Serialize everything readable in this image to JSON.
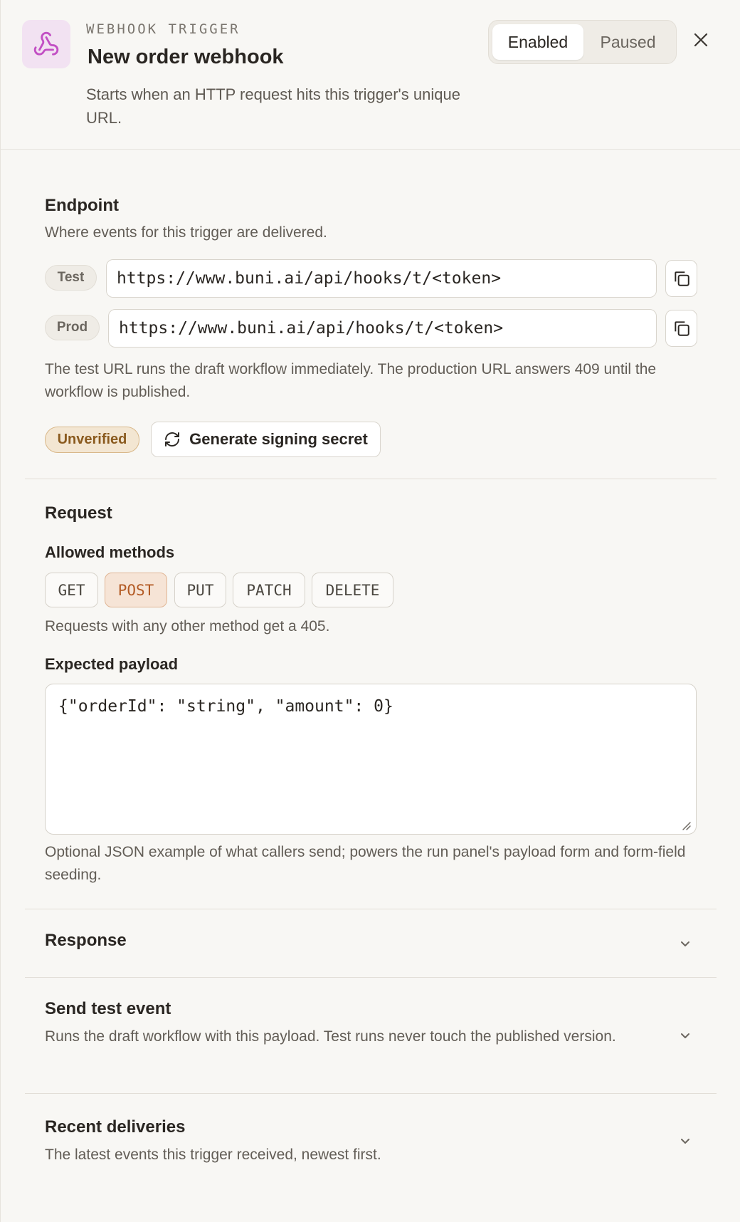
{
  "header": {
    "eyebrow": "WEBHOOK TRIGGER",
    "title": "New order webhook",
    "subtitle": "Starts when an HTTP request hits this trigger's unique URL.",
    "status_options": [
      "Enabled",
      "Paused"
    ],
    "status_selected": "Enabled",
    "icon": "webhook-icon"
  },
  "endpoint": {
    "heading": "Endpoint",
    "description": "Where events for this trigger are delivered.",
    "test_label": "Test",
    "test_url": "https://www.buni.ai/api/hooks/t/<token>",
    "prod_label": "Prod",
    "prod_url": "https://www.buni.ai/api/hooks/t/<token>",
    "note": "The test URL runs the draft workflow immediately. The production URL answers 409 until the workflow is published.",
    "verification_badge": "Unverified",
    "generate_button": "Generate signing secret"
  },
  "request": {
    "heading": "Request",
    "methods_label": "Allowed methods",
    "methods": [
      "GET",
      "POST",
      "PUT",
      "PATCH",
      "DELETE"
    ],
    "selected_method": "POST",
    "methods_note": "Requests with any other method get a 405.",
    "payload_label": "Expected payload",
    "payload_value": "{\"orderId\": \"string\", \"amount\": 0}",
    "payload_note": "Optional JSON example of what callers send; powers the run panel's payload form and form-field seeding."
  },
  "response": {
    "heading": "Response"
  },
  "send_test": {
    "heading": "Send test event",
    "description": "Runs the draft workflow with this payload. Test runs never touch the published version."
  },
  "recent": {
    "heading": "Recent deliveries",
    "description": "The latest events this trigger received, newest first."
  },
  "colors": {
    "accent": "#c24fc4",
    "selected_method": "#b35a24",
    "unverified": "#8a5a1e"
  }
}
